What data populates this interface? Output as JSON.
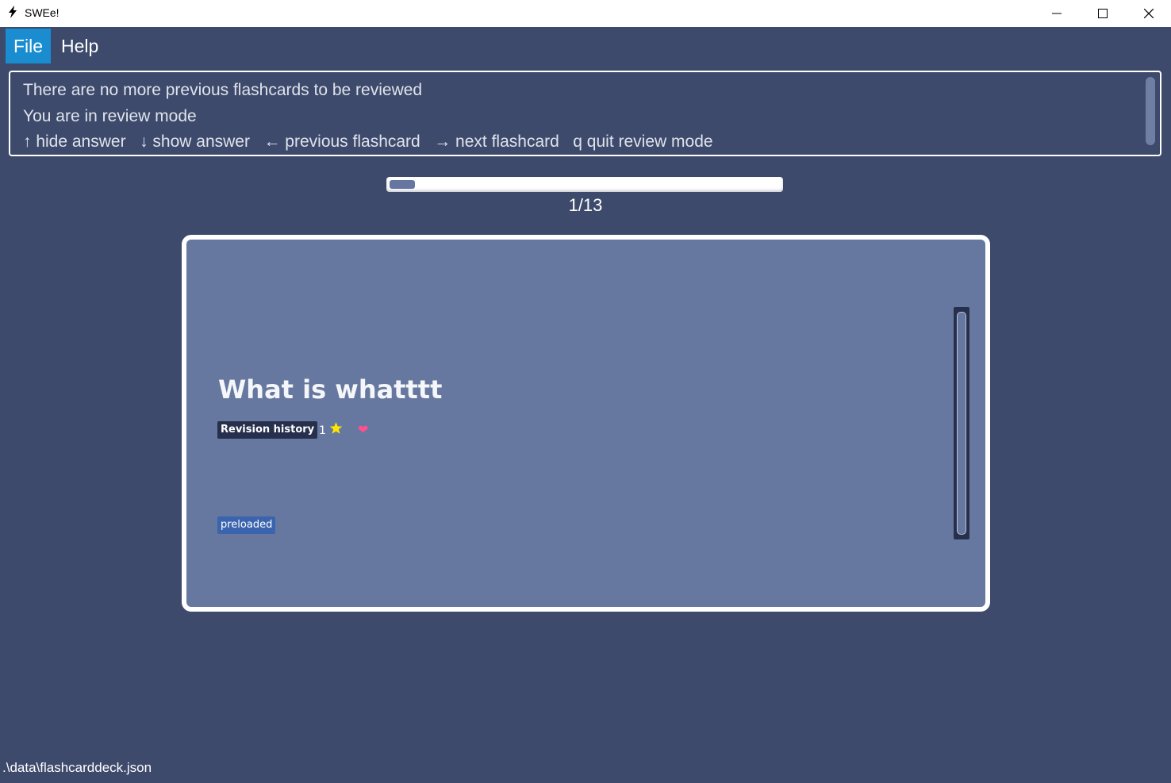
{
  "window": {
    "title": "SWEe!",
    "icon": "lightning-icon"
  },
  "menu": {
    "items": [
      {
        "label": "File"
      },
      {
        "label": "Help"
      }
    ]
  },
  "result": {
    "lines": [
      "There are no more previous flashcards to be reviewed",
      "You are in review mode",
      "↑ hide answer   ↓ show answer   ← previous flashcard   → next flashcard   q quit review mode"
    ]
  },
  "progress": {
    "current": 1,
    "total": 13,
    "label": "1/13"
  },
  "flashcard": {
    "question": "What is whatttt",
    "revision_tag": "Revision history",
    "rating": "1",
    "rating_icon": "star-icon",
    "favourite_icon": "heart-icon",
    "tags": [
      "preloaded"
    ]
  },
  "status": {
    "file_path": ".\\data\\flashcarddeck.json"
  },
  "colors": {
    "background": "#3d4a6b",
    "card": "#66789f",
    "menu_active": "#1a8dd1",
    "tag_dark": "#26304d",
    "tag_blue": "#3a64ae",
    "star": "#ffd700",
    "heart": "#ff4f8f"
  }
}
